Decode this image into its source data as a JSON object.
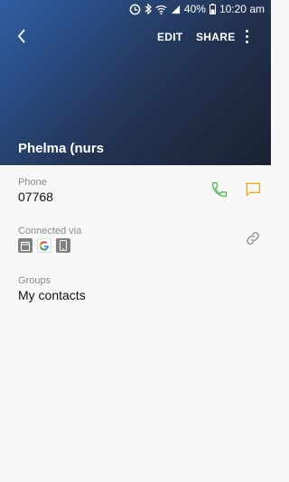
{
  "status_bar": {
    "battery_text": "40%",
    "time": "10:20 am"
  },
  "header": {
    "edit_label": "EDIT",
    "share_label": "SHARE",
    "contact_name": "Phelma (nurs"
  },
  "phone": {
    "label": "Phone",
    "number": "07768"
  },
  "connected": {
    "label": "Connected via",
    "accounts": [
      "calendar-icon",
      "google-icon",
      "phone-device-icon"
    ]
  },
  "groups": {
    "label": "Groups",
    "value": "My contacts"
  },
  "colors": {
    "header_start": "#2f5ea3",
    "header_end": "#1b2233",
    "call_green": "#4caf50",
    "message_orange": "#f5a623"
  }
}
